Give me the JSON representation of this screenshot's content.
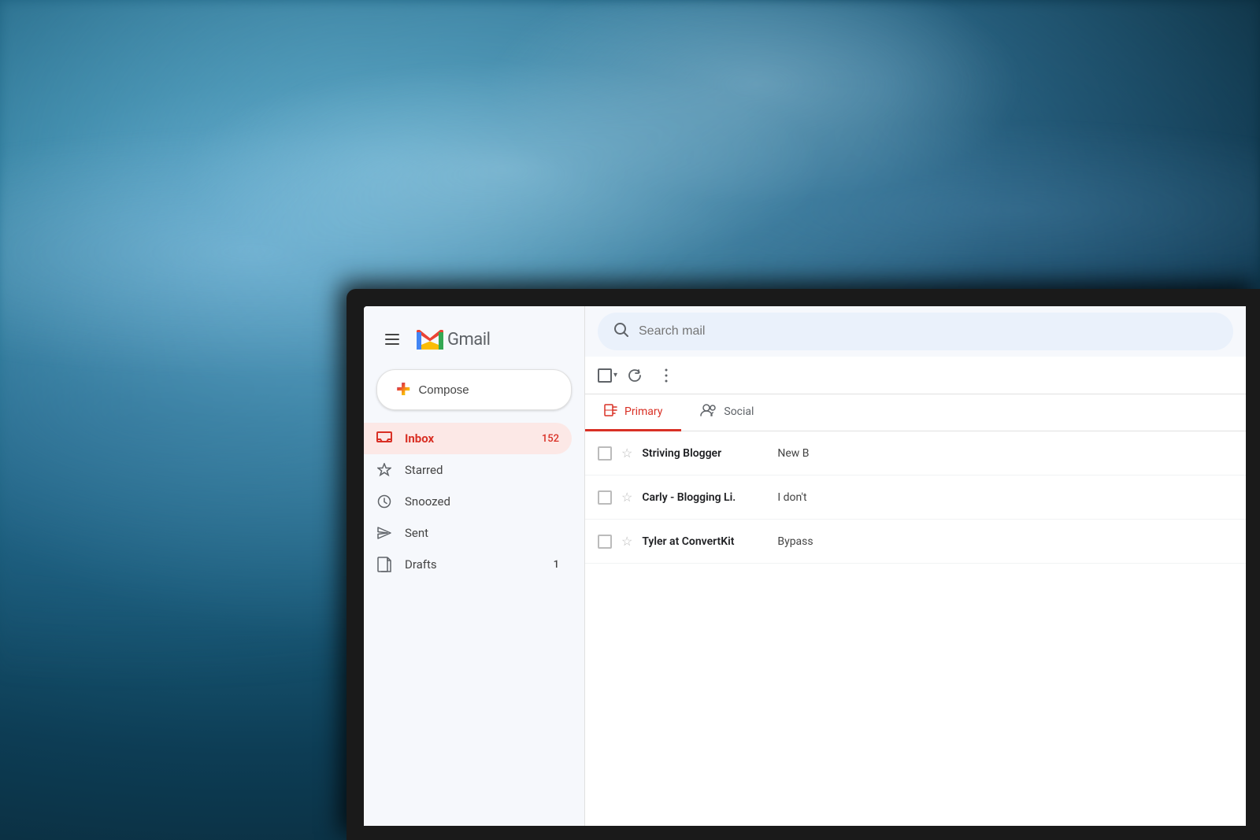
{
  "background": {
    "description": "Blurred teal-blue ocean wave background"
  },
  "gmail": {
    "app_name": "Gmail",
    "logo_alt": "Gmail logo"
  },
  "header": {
    "menu_label": "Main menu",
    "search_placeholder": "Search mail"
  },
  "compose": {
    "label": "Compose",
    "plus_symbol": "+"
  },
  "sidebar": {
    "nav_items": [
      {
        "id": "inbox",
        "label": "Inbox",
        "count": "152",
        "active": true
      },
      {
        "id": "starred",
        "label": "Starred",
        "count": "",
        "active": false
      },
      {
        "id": "snoozed",
        "label": "Snoozed",
        "count": "",
        "active": false
      },
      {
        "id": "sent",
        "label": "Sent",
        "count": "",
        "active": false
      },
      {
        "id": "drafts",
        "label": "Drafts",
        "count": "1",
        "active": false
      }
    ]
  },
  "toolbar": {
    "select_all_label": "Select all",
    "refresh_label": "Refresh",
    "more_label": "More"
  },
  "tabs": [
    {
      "id": "primary",
      "label": "Primary",
      "active": true
    },
    {
      "id": "social",
      "label": "Social",
      "active": false
    }
  ],
  "emails": [
    {
      "sender": "Striving Blogger",
      "subject": "New B",
      "snippet": "",
      "starred": false
    },
    {
      "sender": "Carly - Blogging Li.",
      "subject": "I don't",
      "snippet": "",
      "starred": false
    },
    {
      "sender": "Tyler at ConvertKit",
      "subject": "Bypass",
      "snippet": "",
      "starred": false
    }
  ]
}
